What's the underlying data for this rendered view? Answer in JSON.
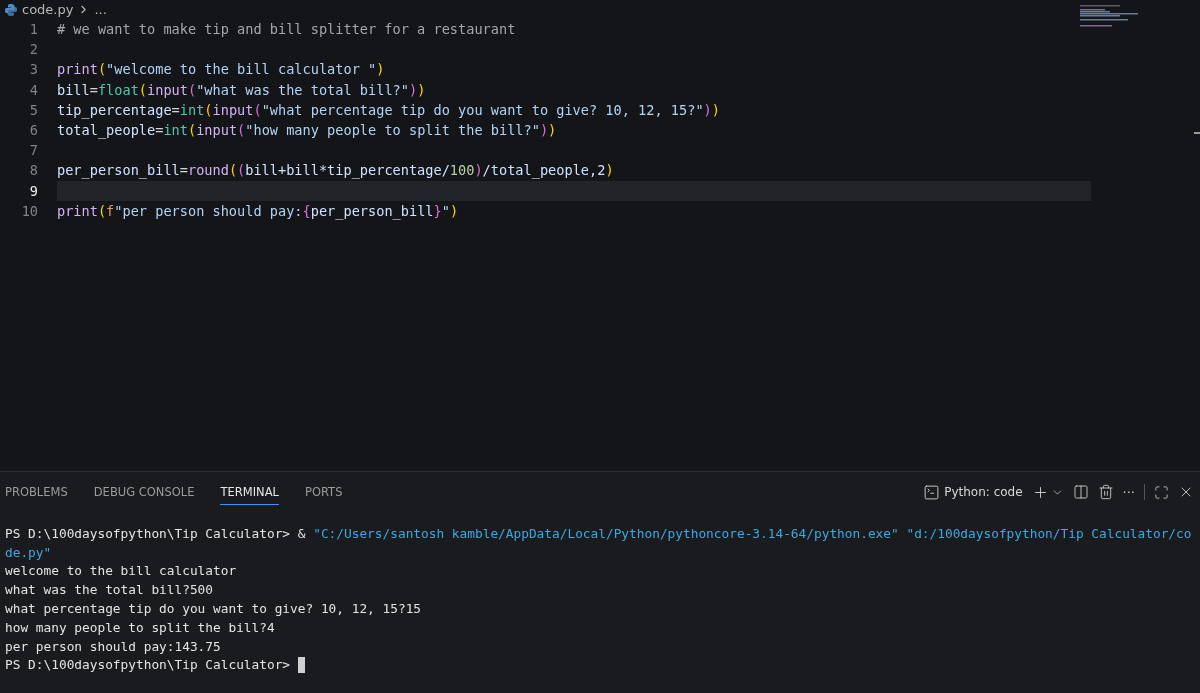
{
  "breadcrumb": {
    "file": "code.py",
    "rest": "..."
  },
  "editor": {
    "lines": [
      {
        "number": "1",
        "active": false,
        "tokens": [
          {
            "kind": "comment",
            "text": "# we want to make tip and bill splitter for a restaurant"
          }
        ]
      },
      {
        "number": "2",
        "active": false
      },
      {
        "number": "3",
        "active": false,
        "tokens": [
          {
            "kind": "fn",
            "text": "print"
          },
          {
            "kind": "br1",
            "text": "("
          },
          {
            "kind": "str",
            "text": "\"welcome to the bill calculator \""
          },
          {
            "kind": "br1",
            "text": ")"
          }
        ]
      },
      {
        "number": "4",
        "active": false,
        "tokens": [
          {
            "kind": "var",
            "text": "bill"
          },
          {
            "kind": "op",
            "text": "="
          },
          {
            "kind": "type",
            "text": "float"
          },
          {
            "kind": "br1",
            "text": "("
          },
          {
            "kind": "fn",
            "text": "input"
          },
          {
            "kind": "br2",
            "text": "("
          },
          {
            "kind": "str",
            "text": "\"what was the total bill?\""
          },
          {
            "kind": "br2",
            "text": ")"
          },
          {
            "kind": "br1",
            "text": ")"
          }
        ]
      },
      {
        "number": "5",
        "active": false,
        "tokens": [
          {
            "kind": "var",
            "text": "tip_percentage"
          },
          {
            "kind": "op",
            "text": "="
          },
          {
            "kind": "type",
            "text": "int"
          },
          {
            "kind": "br1",
            "text": "("
          },
          {
            "kind": "fn",
            "text": "input"
          },
          {
            "kind": "br2",
            "text": "("
          },
          {
            "kind": "str",
            "text": "\"what percentage tip do you want to give? 10, 12, 15?\""
          },
          {
            "kind": "br2",
            "text": ")"
          },
          {
            "kind": "br1",
            "text": ")"
          }
        ]
      },
      {
        "number": "6",
        "active": false,
        "tokens": [
          {
            "kind": "var",
            "text": "total_people"
          },
          {
            "kind": "op",
            "text": "="
          },
          {
            "kind": "type",
            "text": "int"
          },
          {
            "kind": "br1",
            "text": "("
          },
          {
            "kind": "fn",
            "text": "input"
          },
          {
            "kind": "br2",
            "text": "("
          },
          {
            "kind": "str",
            "text": "\"how many people to split the bill?\""
          },
          {
            "kind": "br2",
            "text": ")"
          },
          {
            "kind": "br1",
            "text": ")"
          }
        ]
      },
      {
        "number": "7",
        "active": false
      },
      {
        "number": "8",
        "active": false,
        "tokens": [
          {
            "kind": "var",
            "text": "per_person_bill"
          },
          {
            "kind": "op",
            "text": "="
          },
          {
            "kind": "fn",
            "text": "round"
          },
          {
            "kind": "br1",
            "text": "("
          },
          {
            "kind": "br2",
            "text": "("
          },
          {
            "kind": "var",
            "text": "bill+bill*tip_percentage/"
          },
          {
            "kind": "num",
            "text": "100"
          },
          {
            "kind": "br2",
            "text": ")"
          },
          {
            "kind": "var",
            "text": "/total_people,2"
          },
          {
            "kind": "br1",
            "text": ")"
          }
        ]
      },
      {
        "number": "9",
        "active": true
      },
      {
        "number": "10",
        "active": false,
        "tokens": [
          {
            "kind": "fn",
            "text": "print"
          },
          {
            "kind": "br1",
            "text": "("
          },
          {
            "kind": "prefix",
            "text": "f"
          },
          {
            "kind": "str",
            "text": "\"per person should pay:"
          },
          {
            "kind": "br2",
            "text": "{"
          },
          {
            "kind": "var",
            "text": "per_person_bill"
          },
          {
            "kind": "br2",
            "text": "}"
          },
          {
            "kind": "str",
            "text": "\""
          },
          {
            "kind": "br1",
            "text": ")"
          }
        ]
      }
    ]
  },
  "panel": {
    "tabs": [
      {
        "label": "PROBLEMS",
        "selected": false
      },
      {
        "label": "DEBUG CONSOLE",
        "selected": false
      },
      {
        "label": "TERMINAL",
        "selected": true
      },
      {
        "label": "PORTS",
        "selected": false
      }
    ],
    "terminal_name": "Python: code",
    "more": "···",
    "terminal": [
      [
        {
          "kind": "out",
          "text": "PS D:\\100daysofpython\\Tip Calculator> & "
        },
        {
          "kind": "path",
          "text": "\"C:/Users/santosh kamble/AppData/Local/Python/pythoncore-3.14-64/python.exe\" \"d:/100daysofpython/Tip Calculator/co"
        }
      ],
      [
        {
          "kind": "path",
          "text": "de.py\""
        }
      ],
      [
        {
          "kind": "out",
          "text": "welcome to the bill calculator"
        }
      ],
      [
        {
          "kind": "out",
          "text": "what was the total bill?500"
        }
      ],
      [
        {
          "kind": "out",
          "text": "what percentage tip do you want to give? 10, 12, 15?15"
        }
      ],
      [
        {
          "kind": "out",
          "text": "how many people to split the bill?4"
        }
      ],
      [
        {
          "kind": "out",
          "text": "per person should pay:143.75"
        }
      ],
      [
        {
          "kind": "out",
          "text": "PS D:\\100daysofpython\\Tip Calculator> "
        },
        {
          "kind": "cursor"
        }
      ]
    ]
  }
}
